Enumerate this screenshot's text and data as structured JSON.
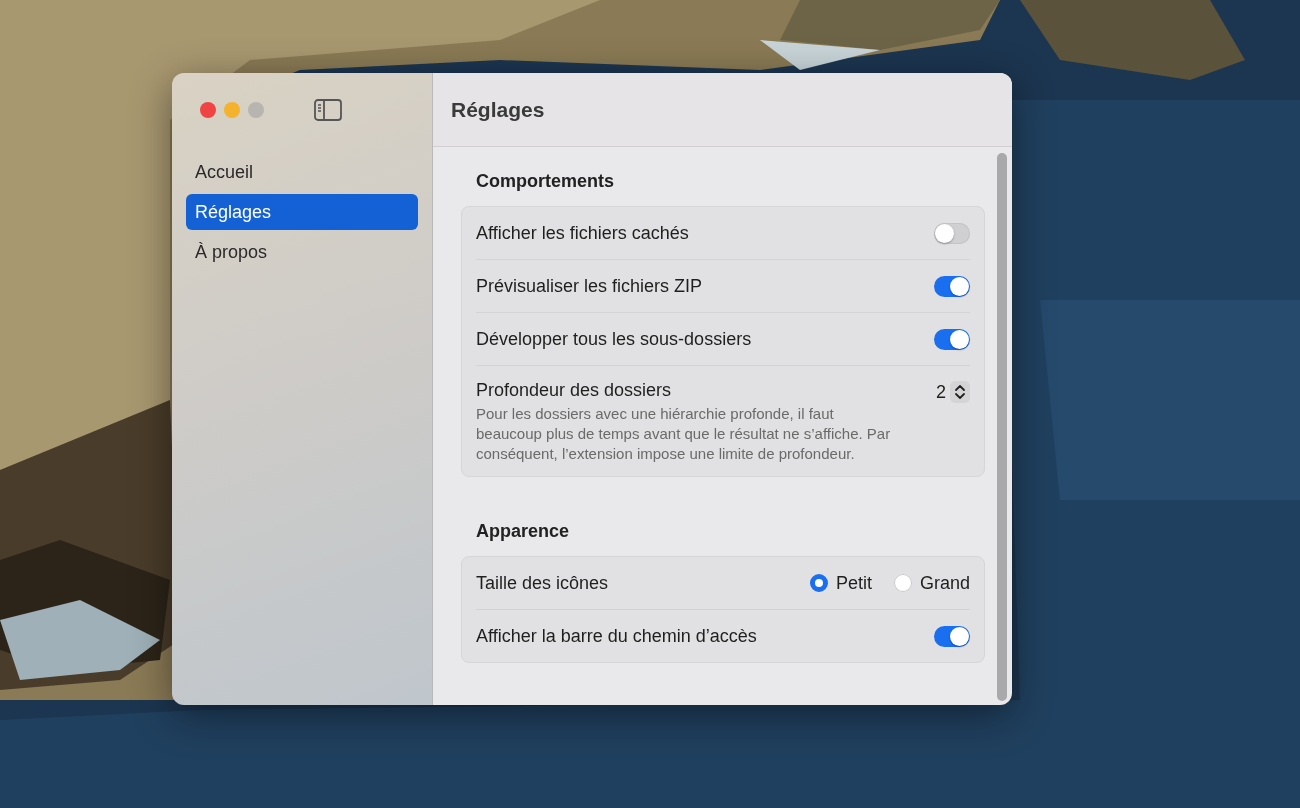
{
  "window": {
    "title": "Réglages"
  },
  "sidebar": {
    "items": [
      {
        "label": "Accueil",
        "selected": false
      },
      {
        "label": "Réglages",
        "selected": true
      },
      {
        "label": "À propos",
        "selected": false
      }
    ]
  },
  "sections": [
    {
      "title": "Comportements",
      "rows": [
        {
          "kind": "toggle",
          "label": "Afficher les fichiers cachés",
          "on": false
        },
        {
          "kind": "toggle",
          "label": "Prévisualiser les fichiers ZIP",
          "on": true
        },
        {
          "kind": "toggle",
          "label": "Développer tous les sous-dossiers",
          "on": true
        },
        {
          "kind": "stepper",
          "label": "Profondeur des dossiers",
          "value": "2",
          "description": "Pour les dossiers avec une hiérarchie profonde, il faut beaucoup plus de temps avant que le résultat ne s’affiche. Par conséquent, l’extension impose une limite de profondeur."
        }
      ]
    },
    {
      "title": "Apparence",
      "rows": [
        {
          "kind": "radio",
          "label": "Taille des icônes",
          "options": [
            {
              "label": "Petit",
              "selected": true
            },
            {
              "label": "Grand",
              "selected": false
            }
          ]
        },
        {
          "kind": "toggle",
          "label": "Afficher la barre du chemin d’accès",
          "on": true
        }
      ]
    }
  ]
}
